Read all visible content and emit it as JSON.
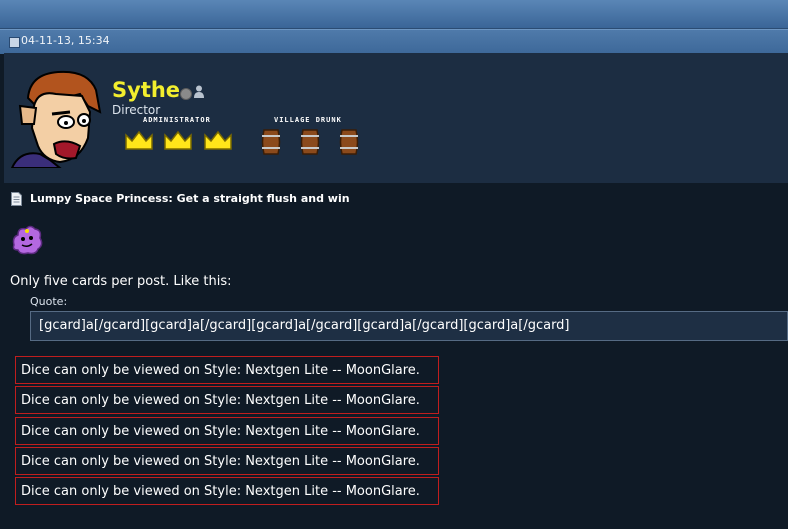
{
  "post_header": {
    "date": "04-11-13, 15:34"
  },
  "user": {
    "name": "Sythe",
    "title": "Director",
    "rank_labels": [
      "ADMINISTRATOR",
      "VILLAGE DRUNK"
    ],
    "name_color": "#f2ee2e",
    "online_status": "offline"
  },
  "post": {
    "title": "Lumpy Space Princess: Get a straight flush and win",
    "body": "Only five cards per post. Like this:",
    "quote_label": "Quote:",
    "quote_text": "[gcard]a[/gcard][gcard]a[/gcard][gcard]a[/gcard][gcard]a[/gcard][gcard]a[/gcard]",
    "dice_messages": [
      "Dice can only be viewed on Style: Nextgen Lite -- MoonGlare.",
      "Dice can only be viewed on Style: Nextgen Lite -- MoonGlare.",
      "Dice can only be viewed on Style: Nextgen Lite -- MoonGlare.",
      "Dice can only be viewed on Style: Nextgen Lite -- MoonGlare.",
      "Dice can only be viewed on Style: Nextgen Lite -- MoonGlare."
    ]
  },
  "colors": {
    "header_blue": "#3d6899",
    "dice_border": "#c01e1e",
    "post_background": "#0f1a26"
  }
}
